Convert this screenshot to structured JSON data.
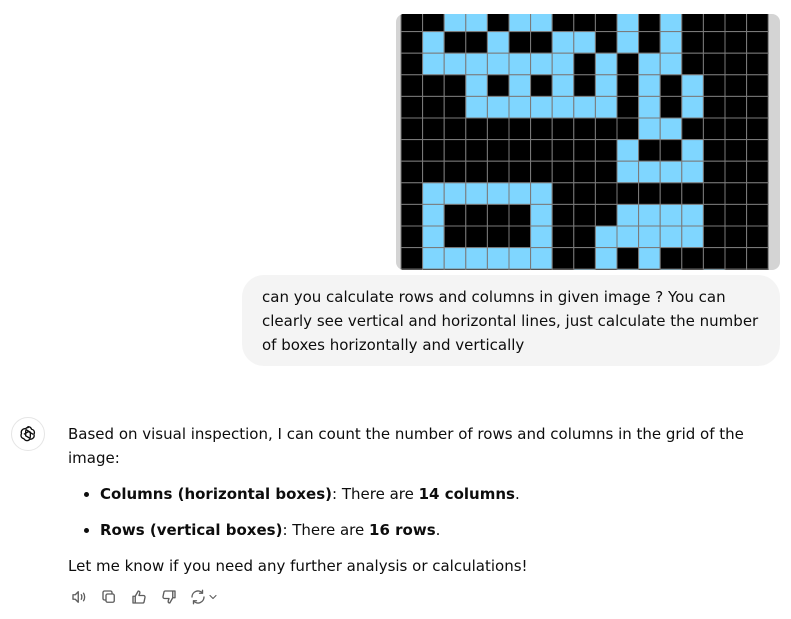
{
  "user_message": {
    "text": "can you calculate rows and columns in given image ? You can clearly see vertical and horizontal lines, just calculate the number of boxes horizontally and vertically"
  },
  "user_image": {
    "colors": {
      "filled": "#7fd6ff",
      "empty": "#000000",
      "gridline": "#7a7a7a",
      "frame": "#d4d4d4"
    },
    "grid_rows": [
      "..##.##...#.#.",
      ".#..#..##.#.#.",
      ".#######.#.##.",
      "...#.#.#.#.#.#",
      "...#######.#.#",
      "...........##.",
      "..........#..#",
      "..........####",
      ".######......",
      ".#....#...####",
      ".#....#..#####",
      ".######..#.#..",
      "........#.#.#.#"
    ]
  },
  "assistant": {
    "avatar_icon": "openai-logo-icon",
    "intro": "Based on visual inspection, I can count the number of rows and columns in the grid of the image:",
    "items": [
      {
        "label": "Columns (horizontal boxes)",
        "mid": ": There are ",
        "value": "14 columns",
        "end": "."
      },
      {
        "label": "Rows (vertical boxes)",
        "mid": ": There are ",
        "value": "16 rows",
        "end": "."
      }
    ],
    "closing": "Let me know if you need any further analysis or calculations!"
  },
  "actions": [
    {
      "icon": "read-aloud-icon"
    },
    {
      "icon": "copy-icon"
    },
    {
      "icon": "thumbs-up-icon"
    },
    {
      "icon": "thumbs-down-icon"
    },
    {
      "icon": "regenerate-icon"
    }
  ]
}
